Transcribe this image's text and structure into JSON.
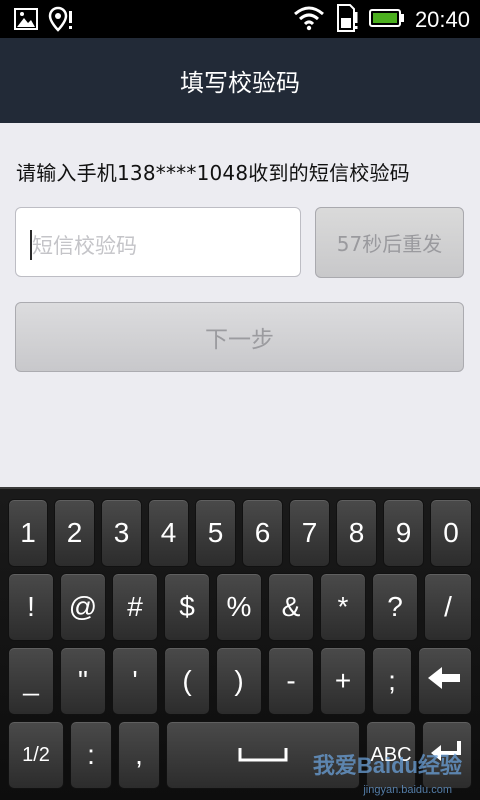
{
  "status": {
    "time": "20:40"
  },
  "header": {
    "title": "填写校验码"
  },
  "form": {
    "prompt": "请输入手机138****1048收到的短信校验码",
    "code_placeholder": "短信校验码",
    "resend_label": "57秒后重发",
    "next_label": "下一步"
  },
  "keyboard": {
    "row1": [
      "1",
      "2",
      "3",
      "4",
      "5",
      "6",
      "7",
      "8",
      "9",
      "0"
    ],
    "row2": [
      "!",
      "@",
      "#",
      "$",
      "%",
      "&",
      "*",
      "?",
      "/"
    ],
    "row3": [
      "_",
      "\"",
      "'",
      "(",
      ")",
      "-",
      "+",
      ";"
    ],
    "row4": {
      "shift_label": "1/2",
      "colon": ":",
      "comma": ",",
      "abc_label": "ABC"
    }
  },
  "watermark": {
    "text": "我爱Baidu经验",
    "sub": "jingyan.baidu.com"
  },
  "colors": {
    "titlebar": "#222a37",
    "content_bg": "#ececf1",
    "battery": "#4caf1f"
  }
}
